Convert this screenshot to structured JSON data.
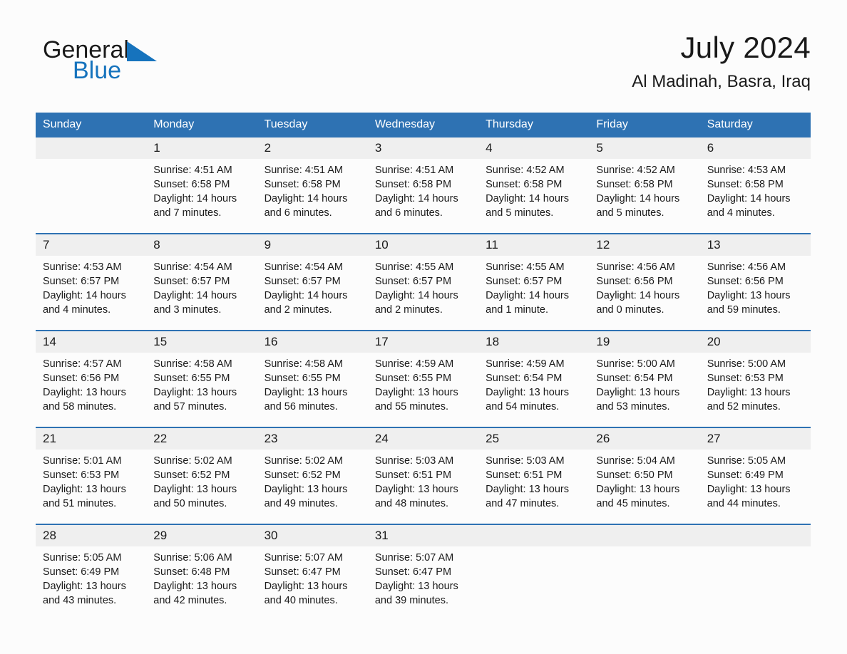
{
  "brand": {
    "name_part1": "General",
    "name_part2": "Blue",
    "triangle_icon": "triangle-icon",
    "accent_color": "#1673bd"
  },
  "header": {
    "title": "July 2024",
    "subtitle": "Al Madinah, Basra, Iraq"
  },
  "theme": {
    "header_blue": "#2e72b3",
    "daynum_band": "#efefef",
    "page_background": "#fcfcfc"
  },
  "calendar": {
    "weekday_headers": [
      "Sunday",
      "Monday",
      "Tuesday",
      "Wednesday",
      "Thursday",
      "Friday",
      "Saturday"
    ],
    "weeks": [
      [
        {
          "day": "",
          "lines": []
        },
        {
          "day": "1",
          "lines": [
            "Sunrise: 4:51 AM",
            "Sunset: 6:58 PM",
            "Daylight: 14 hours",
            "and 7 minutes."
          ]
        },
        {
          "day": "2",
          "lines": [
            "Sunrise: 4:51 AM",
            "Sunset: 6:58 PM",
            "Daylight: 14 hours",
            "and 6 minutes."
          ]
        },
        {
          "day": "3",
          "lines": [
            "Sunrise: 4:51 AM",
            "Sunset: 6:58 PM",
            "Daylight: 14 hours",
            "and 6 minutes."
          ]
        },
        {
          "day": "4",
          "lines": [
            "Sunrise: 4:52 AM",
            "Sunset: 6:58 PM",
            "Daylight: 14 hours",
            "and 5 minutes."
          ]
        },
        {
          "day": "5",
          "lines": [
            "Sunrise: 4:52 AM",
            "Sunset: 6:58 PM",
            "Daylight: 14 hours",
            "and 5 minutes."
          ]
        },
        {
          "day": "6",
          "lines": [
            "Sunrise: 4:53 AM",
            "Sunset: 6:58 PM",
            "Daylight: 14 hours",
            "and 4 minutes."
          ]
        }
      ],
      [
        {
          "day": "7",
          "lines": [
            "Sunrise: 4:53 AM",
            "Sunset: 6:57 PM",
            "Daylight: 14 hours",
            "and 4 minutes."
          ]
        },
        {
          "day": "8",
          "lines": [
            "Sunrise: 4:54 AM",
            "Sunset: 6:57 PM",
            "Daylight: 14 hours",
            "and 3 minutes."
          ]
        },
        {
          "day": "9",
          "lines": [
            "Sunrise: 4:54 AM",
            "Sunset: 6:57 PM",
            "Daylight: 14 hours",
            "and 2 minutes."
          ]
        },
        {
          "day": "10",
          "lines": [
            "Sunrise: 4:55 AM",
            "Sunset: 6:57 PM",
            "Daylight: 14 hours",
            "and 2 minutes."
          ]
        },
        {
          "day": "11",
          "lines": [
            "Sunrise: 4:55 AM",
            "Sunset: 6:57 PM",
            "Daylight: 14 hours",
            "and 1 minute."
          ]
        },
        {
          "day": "12",
          "lines": [
            "Sunrise: 4:56 AM",
            "Sunset: 6:56 PM",
            "Daylight: 14 hours",
            "and 0 minutes."
          ]
        },
        {
          "day": "13",
          "lines": [
            "Sunrise: 4:56 AM",
            "Sunset: 6:56 PM",
            "Daylight: 13 hours",
            "and 59 minutes."
          ]
        }
      ],
      [
        {
          "day": "14",
          "lines": [
            "Sunrise: 4:57 AM",
            "Sunset: 6:56 PM",
            "Daylight: 13 hours",
            "and 58 minutes."
          ]
        },
        {
          "day": "15",
          "lines": [
            "Sunrise: 4:58 AM",
            "Sunset: 6:55 PM",
            "Daylight: 13 hours",
            "and 57 minutes."
          ]
        },
        {
          "day": "16",
          "lines": [
            "Sunrise: 4:58 AM",
            "Sunset: 6:55 PM",
            "Daylight: 13 hours",
            "and 56 minutes."
          ]
        },
        {
          "day": "17",
          "lines": [
            "Sunrise: 4:59 AM",
            "Sunset: 6:55 PM",
            "Daylight: 13 hours",
            "and 55 minutes."
          ]
        },
        {
          "day": "18",
          "lines": [
            "Sunrise: 4:59 AM",
            "Sunset: 6:54 PM",
            "Daylight: 13 hours",
            "and 54 minutes."
          ]
        },
        {
          "day": "19",
          "lines": [
            "Sunrise: 5:00 AM",
            "Sunset: 6:54 PM",
            "Daylight: 13 hours",
            "and 53 minutes."
          ]
        },
        {
          "day": "20",
          "lines": [
            "Sunrise: 5:00 AM",
            "Sunset: 6:53 PM",
            "Daylight: 13 hours",
            "and 52 minutes."
          ]
        }
      ],
      [
        {
          "day": "21",
          "lines": [
            "Sunrise: 5:01 AM",
            "Sunset: 6:53 PM",
            "Daylight: 13 hours",
            "and 51 minutes."
          ]
        },
        {
          "day": "22",
          "lines": [
            "Sunrise: 5:02 AM",
            "Sunset: 6:52 PM",
            "Daylight: 13 hours",
            "and 50 minutes."
          ]
        },
        {
          "day": "23",
          "lines": [
            "Sunrise: 5:02 AM",
            "Sunset: 6:52 PM",
            "Daylight: 13 hours",
            "and 49 minutes."
          ]
        },
        {
          "day": "24",
          "lines": [
            "Sunrise: 5:03 AM",
            "Sunset: 6:51 PM",
            "Daylight: 13 hours",
            "and 48 minutes."
          ]
        },
        {
          "day": "25",
          "lines": [
            "Sunrise: 5:03 AM",
            "Sunset: 6:51 PM",
            "Daylight: 13 hours",
            "and 47 minutes."
          ]
        },
        {
          "day": "26",
          "lines": [
            "Sunrise: 5:04 AM",
            "Sunset: 6:50 PM",
            "Daylight: 13 hours",
            "and 45 minutes."
          ]
        },
        {
          "day": "27",
          "lines": [
            "Sunrise: 5:05 AM",
            "Sunset: 6:49 PM",
            "Daylight: 13 hours",
            "and 44 minutes."
          ]
        }
      ],
      [
        {
          "day": "28",
          "lines": [
            "Sunrise: 5:05 AM",
            "Sunset: 6:49 PM",
            "Daylight: 13 hours",
            "and 43 minutes."
          ]
        },
        {
          "day": "29",
          "lines": [
            "Sunrise: 5:06 AM",
            "Sunset: 6:48 PM",
            "Daylight: 13 hours",
            "and 42 minutes."
          ]
        },
        {
          "day": "30",
          "lines": [
            "Sunrise: 5:07 AM",
            "Sunset: 6:47 PM",
            "Daylight: 13 hours",
            "and 40 minutes."
          ]
        },
        {
          "day": "31",
          "lines": [
            "Sunrise: 5:07 AM",
            "Sunset: 6:47 PM",
            "Daylight: 13 hours",
            "and 39 minutes."
          ]
        },
        {
          "day": "",
          "lines": []
        },
        {
          "day": "",
          "lines": []
        },
        {
          "day": "",
          "lines": []
        }
      ]
    ]
  }
}
